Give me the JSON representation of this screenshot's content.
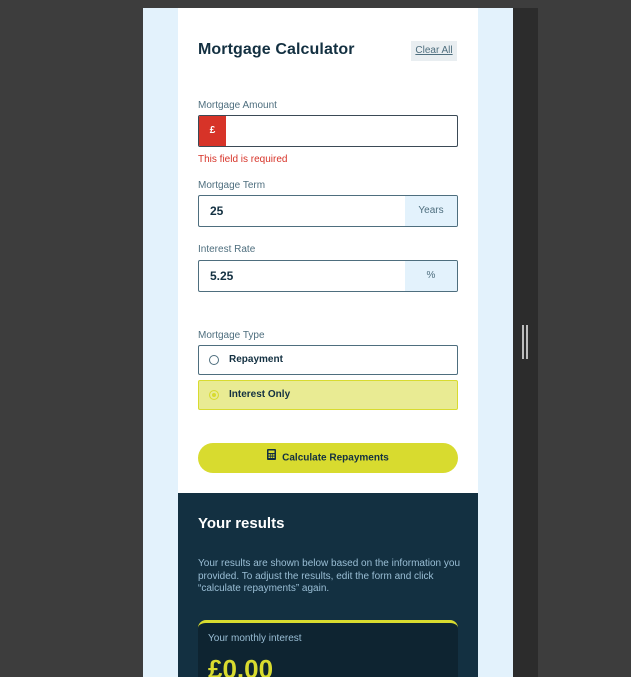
{
  "form": {
    "title": "Mortgage Calculator",
    "clear_label": "Clear All",
    "amount": {
      "label": "Mortgage Amount",
      "prefix": "£",
      "value": "",
      "error": "This field is required"
    },
    "term": {
      "label": "Mortgage Term",
      "value": "25",
      "suffix": "Years"
    },
    "rate": {
      "label": "Interest Rate",
      "value": "5.25",
      "suffix": "%"
    },
    "type": {
      "label": "Mortgage Type",
      "options": [
        {
          "label": "Repayment",
          "selected": false
        },
        {
          "label": "Interest Only",
          "selected": true
        }
      ]
    },
    "submit_label": "Calculate Repayments"
  },
  "results": {
    "title": "Your results",
    "description": "Your results are shown below based on the information you provided. To adjust the results, edit the form and click “calculate repayments” again.",
    "monthly_label": "Your monthly interest",
    "monthly_value": "£0.00"
  },
  "colors": {
    "lime": "#d8db2f",
    "error": "#d73328",
    "slate_900": "#133041",
    "slate_100": "#e3f2fc"
  },
  "icons": {
    "calculator": "calculator-icon"
  }
}
